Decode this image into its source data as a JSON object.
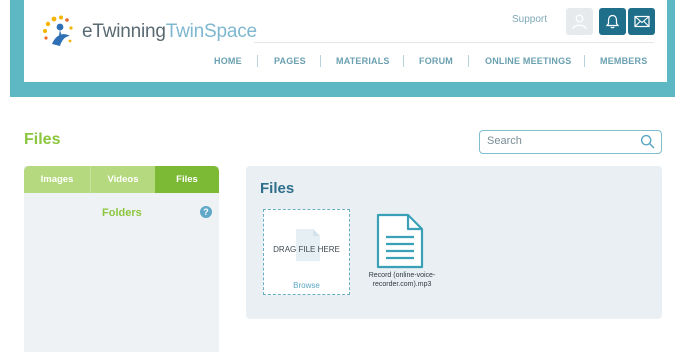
{
  "app": {
    "brand_e": "e",
    "brand_twinning": "Twinning",
    "brand_twinspace": "TwinSpace"
  },
  "header": {
    "support_label": "Support",
    "icons": [
      "user-icon",
      "bell-icon",
      "mail-icon"
    ]
  },
  "nav": {
    "items": [
      "HOME",
      "PAGES",
      "MATERIALS",
      "FORUM",
      "ONLINE MEETINGS",
      "MEMBERS"
    ]
  },
  "page": {
    "title": "Files"
  },
  "search": {
    "placeholder": "Search"
  },
  "sidebar": {
    "tabs": [
      "Images",
      "Videos",
      "Files"
    ],
    "active_tab": "Files",
    "folders_label": "Folders",
    "help_glyph": "?"
  },
  "panel": {
    "title": "Files",
    "dropzone_text": "DRAG FILE HERE",
    "browse_label": "Browse",
    "files": [
      {
        "name": "Record (online-voice-recorder.com).mp3",
        "icon": "document-icon"
      }
    ]
  },
  "colors": {
    "brand_band": "#5eb8c4",
    "accent_green": "#8cc63f",
    "active_tab": "#7cba35",
    "dark_blue": "#1f6f8b",
    "panel_title": "#2f6f8c"
  }
}
